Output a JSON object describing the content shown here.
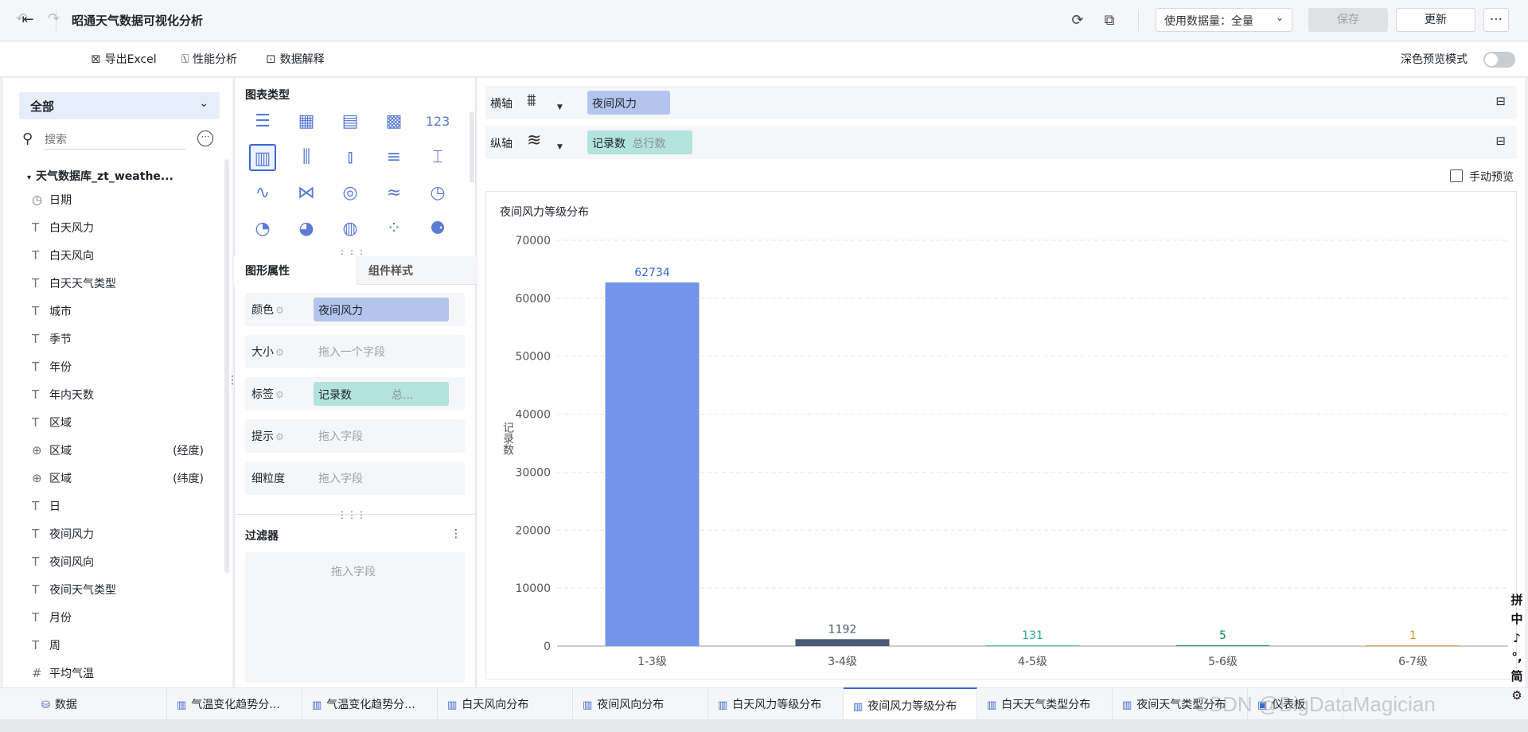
{
  "app": {
    "title": "昭通天气数据可视化分析",
    "data_scope": "使用数据量：全量",
    "save_label": "保存",
    "update_label": "更新",
    "more_label": "⋯"
  },
  "toolbar": {
    "export_label": "导出Excel",
    "perf_label": "性能分析",
    "explain_label": "数据解释",
    "dark_mode_label": "深色预览模式"
  },
  "left": {
    "scope": "全部",
    "search_placeholder": "搜索",
    "db_name": "天气数据库_zt_weathe...",
    "fields": [
      {
        "icon": "clock-icon",
        "glyph": "◷",
        "label": "日期",
        "note": ""
      },
      {
        "icon": "text-type-icon",
        "glyph": "T",
        "label": "白天风力",
        "note": ""
      },
      {
        "icon": "text-type-icon",
        "glyph": "T",
        "label": "白天风向",
        "note": ""
      },
      {
        "icon": "text-type-icon",
        "glyph": "T",
        "label": "白天天气类型",
        "note": ""
      },
      {
        "icon": "text-type-icon",
        "glyph": "T",
        "label": "城市",
        "note": ""
      },
      {
        "icon": "text-type-icon",
        "glyph": "T",
        "label": "季节",
        "note": ""
      },
      {
        "icon": "text-type-icon",
        "glyph": "T",
        "label": "年份",
        "note": ""
      },
      {
        "icon": "text-type-icon",
        "glyph": "T",
        "label": "年内天数",
        "note": ""
      },
      {
        "icon": "text-type-icon",
        "glyph": "T",
        "label": "区域",
        "note": ""
      },
      {
        "icon": "globe-icon",
        "glyph": "⊕",
        "label": "区域",
        "note": "(经度)"
      },
      {
        "icon": "globe-icon",
        "glyph": "⊕",
        "label": "区域",
        "note": "(纬度)"
      },
      {
        "icon": "text-type-icon",
        "glyph": "T",
        "label": "日",
        "note": ""
      },
      {
        "icon": "text-type-icon",
        "glyph": "T",
        "label": "夜间风力",
        "note": ""
      },
      {
        "icon": "text-type-icon",
        "glyph": "T",
        "label": "夜间风向",
        "note": ""
      },
      {
        "icon": "text-type-icon",
        "glyph": "T",
        "label": "夜间天气类型",
        "note": ""
      },
      {
        "icon": "text-type-icon",
        "glyph": "T",
        "label": "月份",
        "note": ""
      },
      {
        "icon": "text-type-icon",
        "glyph": "T",
        "label": "周",
        "note": ""
      },
      {
        "icon": "number-type-icon",
        "glyph": "#",
        "label": "平均气温",
        "note": ""
      }
    ]
  },
  "middle": {
    "chart_type_label": "图表类型",
    "chart_type_icons": [
      "table-icon",
      "cross-table-icon",
      "detail-table-icon",
      "treemap-icon",
      "kpi-number-icon",
      "bar-chart-icon",
      "grouped-bar-icon",
      "stacked-bar-icon",
      "horizontal-bar-icon",
      "waterfall-icon",
      "line-chart-icon",
      "radar-icon",
      "polar-icon",
      "area-chart-icon",
      "gauge-icon",
      "pie-chart-icon",
      "rose-chart-icon",
      "ring-chart-icon",
      "scatter-icon",
      "bubble-icon"
    ],
    "kpi_glyph": "123",
    "tab_shape": "图形属性",
    "tab_style": "组件样式",
    "props": [
      {
        "label": "颜色",
        "value": "夜间风力",
        "value2": "",
        "placeholder": "",
        "pill_color": "#b3c5ec"
      },
      {
        "label": "大小",
        "value": "",
        "value2": "",
        "placeholder": "拖入一个字段",
        "pill_color": ""
      },
      {
        "label": "标签",
        "value": "记录数",
        "value2": "总...",
        "placeholder": "",
        "pill_color": "#b2e3dc"
      },
      {
        "label": "提示",
        "value": "",
        "value2": "",
        "placeholder": "拖入字段",
        "pill_color": ""
      },
      {
        "label": "细粒度",
        "value": "",
        "value2": "",
        "placeholder": "拖入字段",
        "pill_color": ""
      }
    ],
    "filter_label": "过滤器",
    "filter_placeholder": "拖入字段"
  },
  "axes": {
    "x_label": "横轴",
    "x_field": "夜间风力",
    "y_label": "纵轴",
    "y_field": "记录数",
    "y_field_sub": "总行数",
    "manual_preview": "手动预览"
  },
  "chart_data": {
    "type": "bar",
    "title": "夜间风力等级分布",
    "xlabel": "",
    "ylabel": "记录数",
    "categories": [
      "1-3级",
      "3-4级",
      "4-5级",
      "5-6级",
      "6-7级"
    ],
    "values": [
      62734,
      1192,
      131,
      5,
      1
    ],
    "colors": [
      "#7494ea",
      "#4a5a78",
      "#5bc0b0",
      "#2a8f7e",
      "#e8a33a"
    ],
    "label_colors": [
      "#3a66d9",
      "#4a5a78",
      "#2aa893",
      "#1f7d6e",
      "#d8901f"
    ],
    "ylim": [
      0,
      70000
    ],
    "yticks": [
      0,
      10000,
      20000,
      30000,
      40000,
      50000,
      60000,
      70000
    ],
    "grid": true
  },
  "bottom_tabs": [
    {
      "label": "数据",
      "icon": "database-icon",
      "glyph": "⛁",
      "active": false
    },
    {
      "label": "气温变化趋势分...",
      "icon": "chart-icon",
      "glyph": "▥",
      "active": false
    },
    {
      "label": "气温变化趋势分...",
      "icon": "chart-icon",
      "glyph": "▥",
      "active": false
    },
    {
      "label": "白天风向分布",
      "icon": "chart-icon",
      "glyph": "▥",
      "active": false
    },
    {
      "label": "夜间风向分布",
      "icon": "chart-icon",
      "glyph": "▥",
      "active": false
    },
    {
      "label": "白天风力等级分布",
      "icon": "chart-icon",
      "glyph": "▥",
      "active": false
    },
    {
      "label": "夜间风力等级分布",
      "icon": "chart-icon",
      "glyph": "▥",
      "active": true
    },
    {
      "label": "白天天气类型分布",
      "icon": "chart-icon",
      "glyph": "▥",
      "active": false
    },
    {
      "label": "夜间天气类型分布",
      "icon": "chart-icon",
      "glyph": "▥",
      "active": false
    },
    {
      "label": "仪表板",
      "icon": "dashboard-icon",
      "glyph": "▣",
      "active": false
    }
  ],
  "watermark": "CSDN @BigDataMagician",
  "ime_chars": [
    "拼",
    "中",
    "♪",
    "°,",
    "简",
    "⚙"
  ]
}
